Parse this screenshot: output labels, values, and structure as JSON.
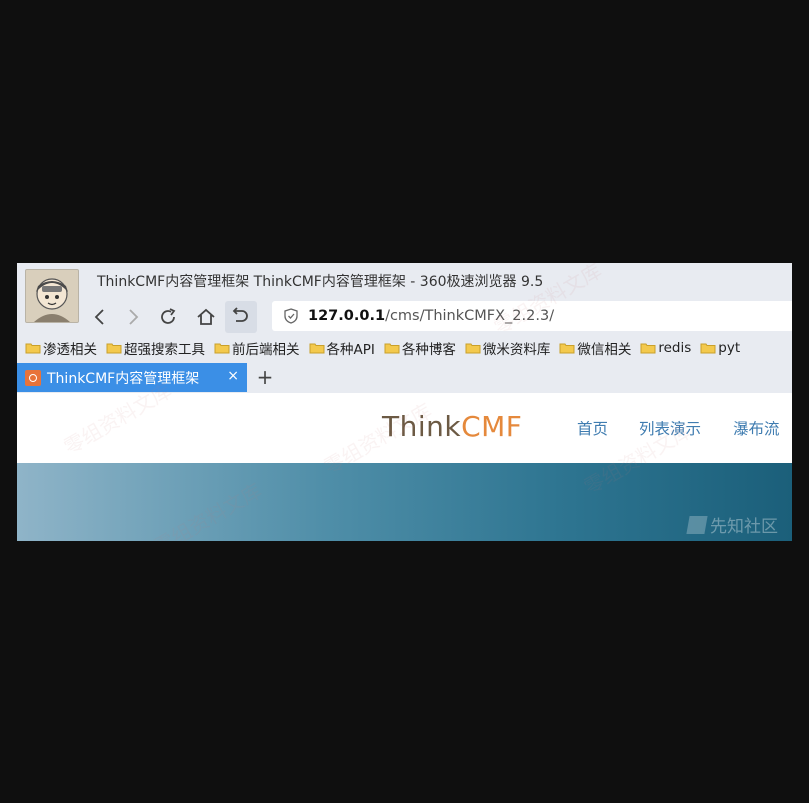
{
  "window": {
    "title": "ThinkCMF内容管理框架 ThinkCMF内容管理框架 - 360极速浏览器 9.5"
  },
  "address": {
    "host": "127.0.0.1",
    "path": "/cms/ThinkCMFX_2.2.3/"
  },
  "bookmarks": [
    {
      "label": "渗透相关"
    },
    {
      "label": "超强搜索工具"
    },
    {
      "label": "前后端相关"
    },
    {
      "label": "各种API"
    },
    {
      "label": "各种博客"
    },
    {
      "label": "微米资料库"
    },
    {
      "label": "微信相关"
    },
    {
      "label": "redis"
    },
    {
      "label": "pyt"
    }
  ],
  "tab": {
    "title": "ThinkCMF内容管理框架",
    "close": "×",
    "new": "+"
  },
  "site": {
    "logo_think": "Think",
    "logo_cmf": "CMF",
    "menu": [
      "首页",
      "列表演示",
      "瀑布流"
    ]
  },
  "watermarks": {
    "site": "先知社区",
    "repeated": "零组资料文库"
  },
  "colors": {
    "tab_active": "#3b8fe6",
    "logo_accent": "#e5893c",
    "menu_link": "#3f7cb0"
  }
}
